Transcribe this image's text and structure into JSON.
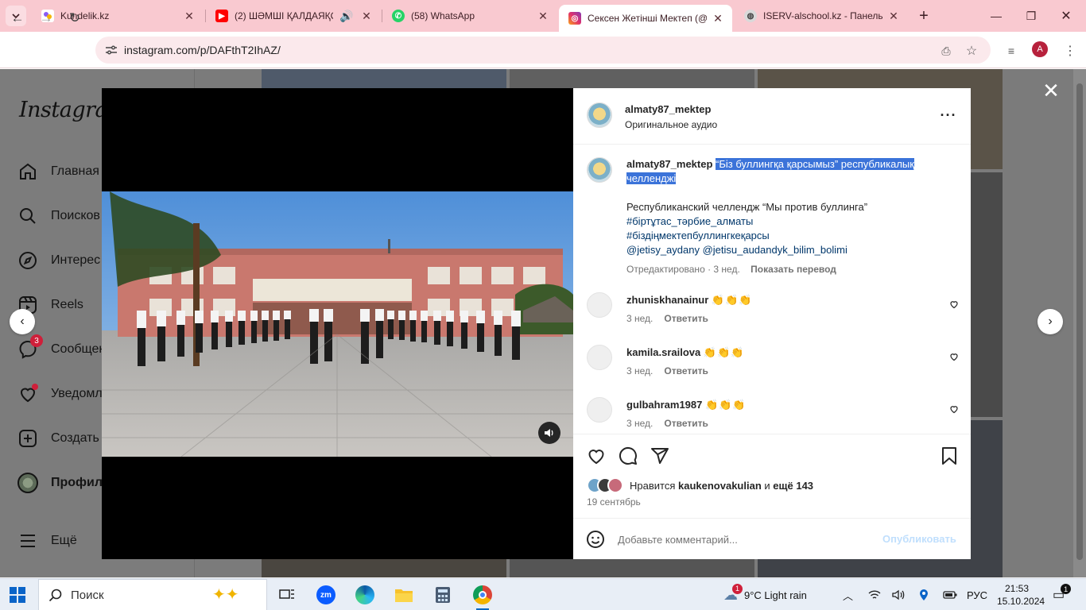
{
  "browser": {
    "tabs": [
      {
        "title": "Kundelik.kz",
        "icon": "kundelik-icon",
        "active": false
      },
      {
        "title": "(2) ШӘМШІ ҚАЛДАЯҚО",
        "icon": "youtube-icon",
        "active": false
      },
      {
        "title": "(58) WhatsApp",
        "icon": "whatsapp-icon",
        "active": false
      },
      {
        "title": "Сексен Жетінші Мектеп (@",
        "icon": "instagram-icon",
        "active": true
      },
      {
        "title": "ISERV-alschool.kz - Панель у",
        "icon": "globe-icon",
        "active": false
      }
    ],
    "url": "instagram.com/p/DAFthT2IhAZ/",
    "profile_initial": "A"
  },
  "sidebar": {
    "logo": "Instagram",
    "items": [
      {
        "label": "Главная",
        "icon": "home-icon"
      },
      {
        "label": "Поисков",
        "icon": "search-icon"
      },
      {
        "label": "Интерес",
        "icon": "compass-icon"
      },
      {
        "label": "Reels",
        "icon": "reels-icon"
      },
      {
        "label": "Сообщен",
        "icon": "messenger-icon",
        "badge": "3"
      },
      {
        "label": "Уведомл",
        "icon": "heart-icon"
      },
      {
        "label": "Создать",
        "icon": "plus-icon"
      },
      {
        "label": "Профил",
        "icon": "profile-avatar"
      },
      {
        "label": "Ещё",
        "icon": "menu-icon"
      }
    ]
  },
  "post": {
    "username": "almaty87_mektep",
    "audio": "Оригинальное аудио",
    "caption_title": "“Біз буллингқа қарсымыз” республикалық челленджі",
    "caption_lines": [
      "Республиканский челлендж “Мы против буллинга”",
      "#біртұтас_тәрбие_алматы",
      "#біздіңмектепбуллингкеқарсы",
      "@jetisy_aydany @jetisu_audandyk_bilim_bolimi"
    ],
    "caption_meta": "Отредактировано · 3 нед.",
    "translate_label": "Показать перевод",
    "comments": [
      {
        "user": "zhuniskhanainur",
        "text": "👏👏👏",
        "age": "3 нед.",
        "reply": "Ответить"
      },
      {
        "user": "kamila.srailova",
        "text": "👏👏👏",
        "age": "3 нед.",
        "reply": "Ответить"
      },
      {
        "user": "gulbahram1987",
        "text": "👏👏👏",
        "age": "3 нед.",
        "reply": "Ответить"
      }
    ],
    "likes_prefix": "Нравится",
    "likes_user": "kaukenovakulian",
    "likes_and": "и",
    "likes_more": "ещё 143",
    "date": "19 сентябрь",
    "comment_placeholder": "Добавьте комментарий...",
    "publish_label": "Опубликовать"
  },
  "taskbar": {
    "search_label": "Поиск",
    "weather": "9°C  Light rain",
    "weather_badge": "1",
    "lang": "РУС",
    "time": "21:53",
    "date": "15.10.2024",
    "notif_count": "1"
  },
  "colors": {
    "tabstrip": "#f9c9d0",
    "selection": "#3b73d9",
    "link": "#00376b",
    "publish_disabled": "#c0dffd"
  }
}
